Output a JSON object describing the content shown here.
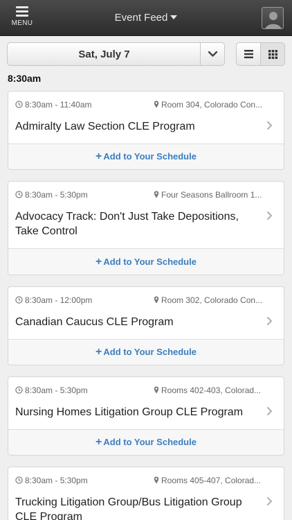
{
  "header": {
    "menu_label": "MENU",
    "title": "Event Feed"
  },
  "date_picker": {
    "date": "Sat, July 7"
  },
  "time_group": "8:30am",
  "events": [
    {
      "time": "8:30am - 11:40am",
      "location": "Room 304, Colorado Con...",
      "title": "Admiralty Law Section CLE Program",
      "add_label": "Add to Your Schedule"
    },
    {
      "time": "8:30am - 5:30pm",
      "location": "Four Seasons Ballroom 1...",
      "title": "Advocacy Track: Don't Just Take Depositions, Take Control",
      "add_label": "Add to Your Schedule"
    },
    {
      "time": "8:30am - 12:00pm",
      "location": "Room 302, Colorado Con...",
      "title": "Canadian Caucus CLE Program",
      "add_label": "Add to Your Schedule"
    },
    {
      "time": "8:30am - 5:30pm",
      "location": "Rooms 402-403, Colorad...",
      "title": "Nursing Homes Litigation Group CLE Program",
      "add_label": "Add to Your Schedule"
    },
    {
      "time": "8:30am - 5:30pm",
      "location": "Rooms 405-407, Colorad...",
      "title": "Trucking Litigation Group/Bus Litigation Group CLE Program",
      "add_label": ""
    }
  ]
}
